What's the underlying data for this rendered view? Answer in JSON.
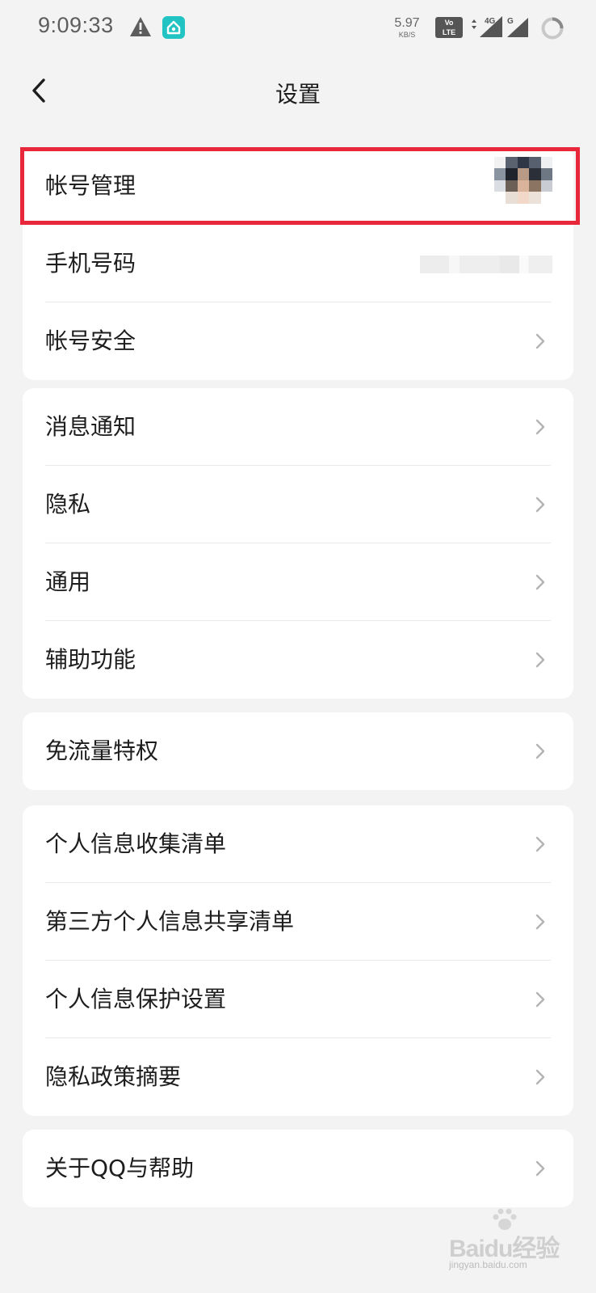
{
  "status_bar": {
    "time": "9:09:33",
    "net_speed_value": "5.97",
    "net_speed_unit": "KB/S",
    "volte_line1": "Vo",
    "volte_line2": "LTE",
    "sim1_label": "4G",
    "sim2_label": "G"
  },
  "header": {
    "title": "设置"
  },
  "groups": [
    {
      "items": [
        {
          "label": "帐号管理",
          "accessory": "avatar",
          "highlighted": true
        },
        {
          "label": "手机号码",
          "accessory": "masked-phone"
        },
        {
          "label": "帐号安全",
          "accessory": "chevron"
        }
      ]
    },
    {
      "items": [
        {
          "label": "消息通知",
          "accessory": "chevron"
        },
        {
          "label": "隐私",
          "accessory": "chevron"
        },
        {
          "label": "通用",
          "accessory": "chevron"
        },
        {
          "label": "辅助功能",
          "accessory": "chevron"
        }
      ]
    },
    {
      "items": [
        {
          "label": "免流量特权",
          "accessory": "chevron"
        }
      ]
    },
    {
      "items": [
        {
          "label": "个人信息收集清单",
          "accessory": "chevron"
        },
        {
          "label": "第三方个人信息共享清单",
          "accessory": "chevron"
        },
        {
          "label": "个人信息保护设置",
          "accessory": "chevron"
        },
        {
          "label": "隐私政策摘要",
          "accessory": "chevron"
        }
      ]
    },
    {
      "items": [
        {
          "label": "关于QQ与帮助",
          "accessory": "chevron"
        }
      ]
    }
  ],
  "colors": {
    "background": "#f3f3f3",
    "card": "#ffffff",
    "highlight_border": "#e8273b",
    "chevron": "#b3b3b3",
    "status_accent": "#22c3c3"
  },
  "watermark": {
    "text": "Baidu经验",
    "subtext": "jingyan.baidu.com"
  }
}
